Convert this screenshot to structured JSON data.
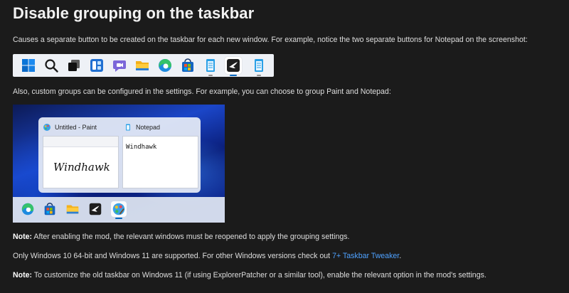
{
  "title": "Disable grouping on the taskbar",
  "intro": "Causes a separate button to be created on the taskbar for each new window. For example, notice the two separate buttons for Notepad on the screenshot:",
  "taskbar_icons": [
    "windows-start-icon",
    "search-icon",
    "task-view-icon",
    "widgets-icon",
    "teams-chat-icon",
    "file-explorer-icon",
    "edge-icon",
    "microsoft-store-icon",
    "notepad-icon",
    "windhawk-icon",
    "notepad-icon"
  ],
  "custom_groups": "Also, custom groups can be configured in the settings. For example, you can choose to group Paint and Notepad:",
  "screenshot": {
    "paint_title": "Untitled - Paint",
    "notepad_title": "Notepad",
    "paint_canvas_text": "Windhawk",
    "notepad_text": "Windhawk",
    "taskbar_icons": [
      "edge-icon",
      "microsoft-store-icon",
      "file-explorer-icon",
      "windhawk-icon",
      "paint-icon"
    ]
  },
  "note1": {
    "label": "Note:",
    "text": " After enabling the mod, the relevant windows must be reopened to apply the grouping settings."
  },
  "support": {
    "text": "Only Windows 10 64-bit and Windows 11 are supported. For other Windows versions check out ",
    "link": "7+ Taskbar Tweaker",
    "end": "."
  },
  "note2": {
    "label": "Note:",
    "text": " To customize the old taskbar on Windows 11 (if using ExplorerPatcher or a similar tool), enable the relevant option in the mod's settings."
  },
  "colors": {
    "background": "#1b1b1b",
    "link": "#4ea1ff",
    "accent": "#0067c0"
  }
}
